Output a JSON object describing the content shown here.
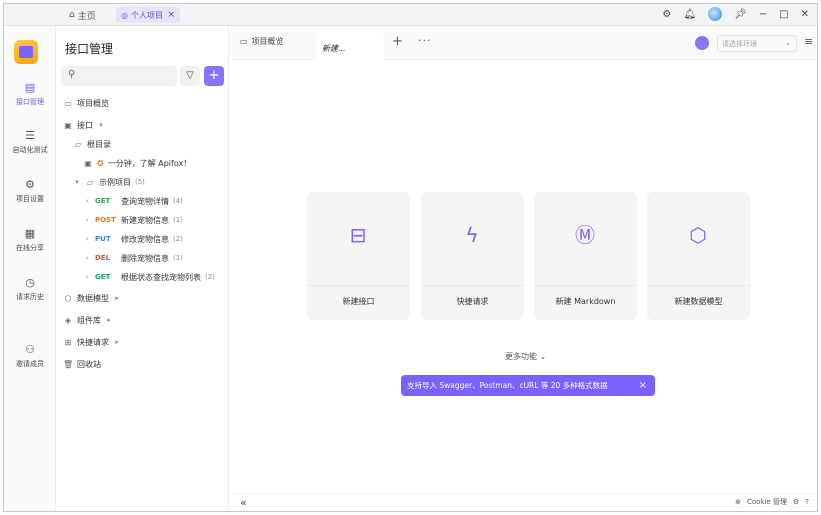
{
  "topbar": {
    "home_tab": "主页",
    "project_tab": "个人项目",
    "close_glyph": "×"
  },
  "rail": {
    "items": [
      {
        "label": "接口管理",
        "icon": "api-icon"
      },
      {
        "label": "自动化测试",
        "icon": "automation-icon"
      },
      {
        "label": "项目设置",
        "icon": "settings-icon"
      },
      {
        "label": "在线分享",
        "icon": "share-icon"
      },
      {
        "label": "请求历史",
        "icon": "history-icon"
      },
      {
        "label": "邀请成员",
        "icon": "invite-icon"
      }
    ]
  },
  "sidebar": {
    "title": "接口管理",
    "add_glyph": "+",
    "overview": "项目概览",
    "api_group": "接口",
    "root": "根目录",
    "intro_doc": "一分钟，了解 Apifox！",
    "example_folder": "示例项目",
    "example_count": "(5)",
    "endpoints": [
      {
        "method": "GET",
        "name": "查询宠物详情",
        "count": "(4)"
      },
      {
        "method": "POST",
        "name": "新建宠物信息",
        "count": "(1)"
      },
      {
        "method": "PUT",
        "name": "修改宠物信息",
        "count": "(2)"
      },
      {
        "method": "DEL",
        "name": "删除宠物信息",
        "count": "(1)"
      },
      {
        "method": "GET",
        "name": "根据状态查找宠物列表",
        "count": "(2)"
      }
    ],
    "data_models": "数据模型",
    "components": "组件库",
    "quick_requests": "快捷请求",
    "recycle_bin": "回收站"
  },
  "main": {
    "tabs": [
      "项目概览",
      "新建..."
    ],
    "env_placeholder": "请选择环境",
    "cards": [
      "新建接口",
      "快捷请求",
      "新建 Markdown",
      "新建数据模型"
    ],
    "more_label": "更多功能",
    "toast": "支持导入 Swagger、Postman、cURL 等 20 多种格式数据",
    "status_cookie": "Cookie 管理"
  },
  "colors": {
    "accent": "#7b61ff",
    "get": "#25a55f",
    "post": "#f07023",
    "put": "#3b7ee8",
    "del": "#e5484d"
  }
}
